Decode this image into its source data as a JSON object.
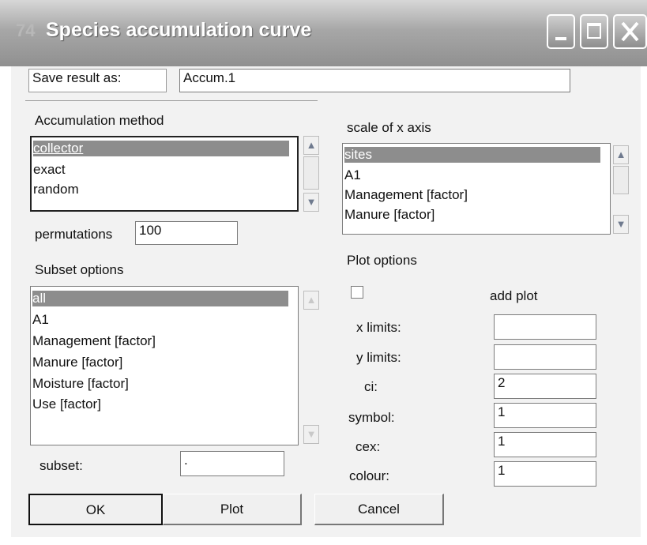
{
  "window": {
    "title": "Species accumulation curve",
    "icon": "74"
  },
  "save": {
    "label": "Save result as:",
    "value": "Accum.1"
  },
  "accumulation": {
    "label": "Accumulation method",
    "items": [
      "collector",
      "exact",
      "random"
    ],
    "selected": "collector"
  },
  "permutations": {
    "label": "permutations",
    "value": "100"
  },
  "subset_options": {
    "label": "Subset options",
    "items": [
      "all",
      "A1",
      "Management [factor]",
      "Manure [factor]",
      "Moisture [factor]",
      "Use [factor]"
    ],
    "selected": "all"
  },
  "subset": {
    "label": "subset:",
    "value": "."
  },
  "x_axis": {
    "label": "scale of x axis",
    "items": [
      "sites",
      "A1",
      "Management [factor]",
      "Manure [factor]"
    ],
    "selected": "sites"
  },
  "plot_options": {
    "label": "Plot options",
    "add_plot": {
      "label": "add plot",
      "checked": false
    },
    "x_limits": {
      "label": "x limits:",
      "value": ""
    },
    "y_limits": {
      "label": "y limits:",
      "value": ""
    },
    "ci": {
      "label": "ci:",
      "value": "2"
    },
    "symbol": {
      "label": "symbol:",
      "value": "1"
    },
    "cex": {
      "label": "cex:",
      "value": "1"
    },
    "colour": {
      "label": "colour:",
      "value": "1"
    }
  },
  "buttons": {
    "ok": "OK",
    "plot": "Plot",
    "cancel": "Cancel"
  }
}
